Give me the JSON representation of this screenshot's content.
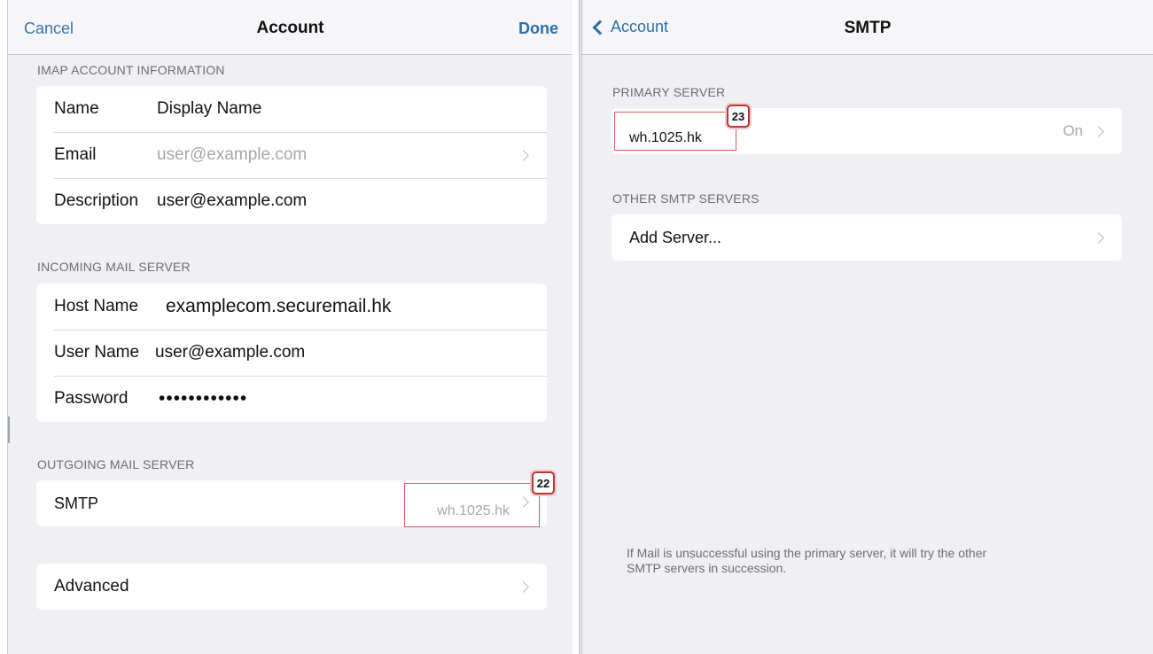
{
  "account": {
    "nav": {
      "cancel": "Cancel",
      "title": "Account",
      "done": "Done"
    },
    "imap_section": {
      "header": "IMAP ACCOUNT INFORMATION",
      "rows": [
        {
          "label": "Name",
          "value": "Display Name"
        },
        {
          "label": "Email",
          "value": "user@example.com"
        },
        {
          "label": "Description",
          "value": "user@example.com"
        }
      ]
    },
    "incoming_section": {
      "header": "INCOMING MAIL SERVER",
      "rows": [
        {
          "label": "Host Name",
          "value": "examplecom.securemail.hk"
        },
        {
          "label": "User Name",
          "value": "user@example.com"
        },
        {
          "label": "Password",
          "value": "••••••••••••"
        }
      ]
    },
    "outgoing_section": {
      "header": "OUTGOING MAIL SERVER",
      "smtp_label": "SMTP",
      "smtp_value": "wh.1025.hk",
      "badge": "22"
    },
    "advanced_label": "Advanced"
  },
  "smtp": {
    "nav": {
      "back": "Account",
      "title": "SMTP"
    },
    "primary_section": {
      "header": "PRIMARY SERVER",
      "server": "wh.1025.hk",
      "status": "On",
      "badge": "23"
    },
    "other_section": {
      "header": "OTHER SMTP SERVERS",
      "add_label": "Add Server..."
    },
    "footer_line1": "If Mail is unsuccessful using the primary server, it will try the other",
    "footer_line2": "SMTP servers in succession."
  },
  "colors": {
    "accent": "#2b6ea8",
    "highlight": "#d85a5a",
    "background": "#efeff4"
  }
}
